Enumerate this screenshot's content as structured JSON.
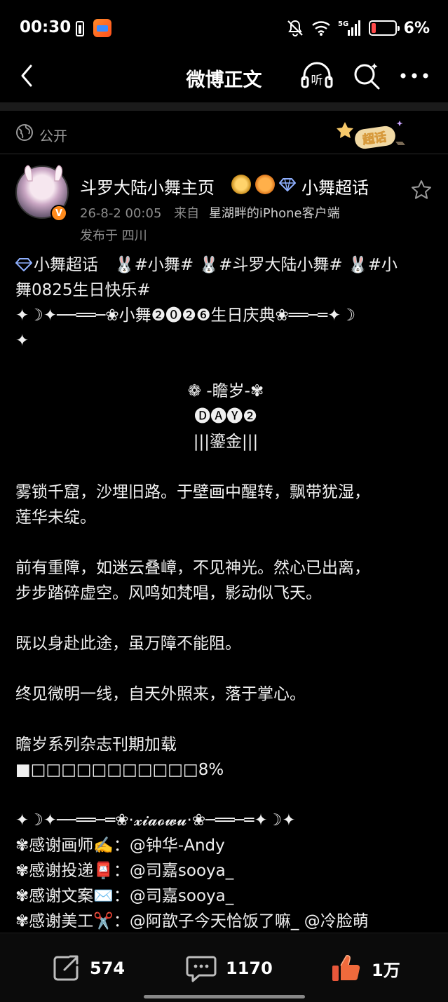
{
  "status_bar": {
    "time": "00:30",
    "battery_percent": "6%",
    "network": "5G",
    "icons": [
      "battery-small-icon",
      "app-icon",
      "mute-icon",
      "wifi-icon",
      "signal-icon",
      "battery-icon"
    ]
  },
  "nav": {
    "title": "微博正文",
    "listen_label": "听",
    "icons": [
      "back-icon",
      "listen-icon",
      "search-icon",
      "more-icon"
    ]
  },
  "visibility": {
    "label": "公开",
    "badge_text": "超话"
  },
  "post": {
    "username": "斗罗大陆小舞主页",
    "topic_link": "小舞超话",
    "time": "26-8-2 00:05",
    "from_label": "来自",
    "client": "星湖畔的iPhone客户端",
    "location": "发布于 四川",
    "verified_mark": "V",
    "lines": [
      "小舞超话　🐰#小舞# 🐰#斗罗大陆小舞# 🐰#小",
      "舞0825生日快乐#",
      "✦☽✦──══─❀小舞❷⓿❷❻生日庆典❀══─═✦☽",
      "✦",
      "",
      "❁ -瞻岁-✾",
      "🅓🅐🅨❷",
      "|||鎏金|||",
      "",
      "雾锁千窟，沙埋旧路。于壁画中醒转，飘带犹湿，",
      "莲华未绽。",
      "",
      "前有重障，如迷云叠嶂，不见神光。然心已出离，",
      "步步踏碎虚空。风鸣如梵唱，影动似飞天。",
      "",
      "既以身赴此途，虽万障不能阻。",
      "",
      "终见微明一线，自天外照来，落于掌心。",
      "",
      "瞻岁系列杂志刊期加载",
      "■□□□□□□□□□□□8%",
      "",
      "✦☽✦──══─═❀·𝔁𝓲𝓪𝓸𝔀𝓾·❀─══─═✦☽✦",
      "✾感谢画师✍️：@钟华-Andy",
      "✾感谢投递📮：@司嘉sooya_",
      "✾感谢文案✉️：@司嘉sooya_",
      "✾感谢美工✂️：@阿歆子今天恰饭了嘛_ @冷脸萌"
    ]
  },
  "actions": {
    "share_count": "574",
    "comment_count": "1170",
    "like_count": "1万"
  }
}
